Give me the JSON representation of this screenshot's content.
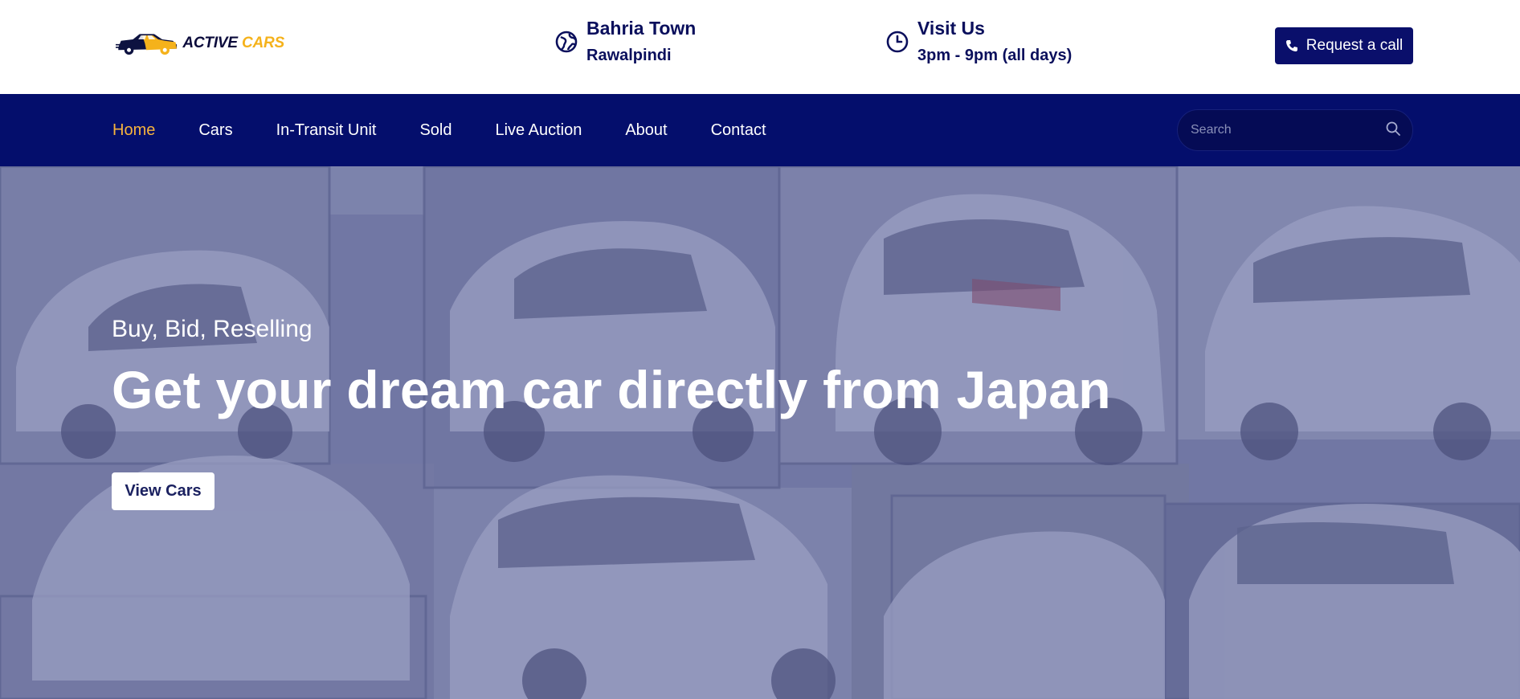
{
  "brand": {
    "logo_word1": "ACTIVE",
    "logo_word2": "CARS",
    "color_primary": "#0a0f6b",
    "color_accent": "#f5b21b"
  },
  "header": {
    "location": {
      "icon": "globe-icon",
      "line1": "Bahria Town",
      "line2": "Rawalpindi"
    },
    "hours": {
      "icon": "clock-icon",
      "line1": "Visit Us",
      "line2": "3pm - 9pm (all days)"
    },
    "call_button": {
      "icon": "phone-icon",
      "label": "Request a call"
    }
  },
  "nav": {
    "items": [
      {
        "label": "Home",
        "active": true
      },
      {
        "label": "Cars",
        "active": false
      },
      {
        "label": "In-Transit Unit",
        "active": false
      },
      {
        "label": "Sold",
        "active": false
      },
      {
        "label": "Live Auction",
        "active": false
      },
      {
        "label": "About",
        "active": false
      },
      {
        "label": "Contact",
        "active": false
      }
    ],
    "search": {
      "placeholder": "Search",
      "icon": "search-icon"
    }
  },
  "hero": {
    "subtitle": "Buy, Bid, Reselling",
    "title": "Get your dream car directly from Japan",
    "button_label": "View Cars"
  }
}
